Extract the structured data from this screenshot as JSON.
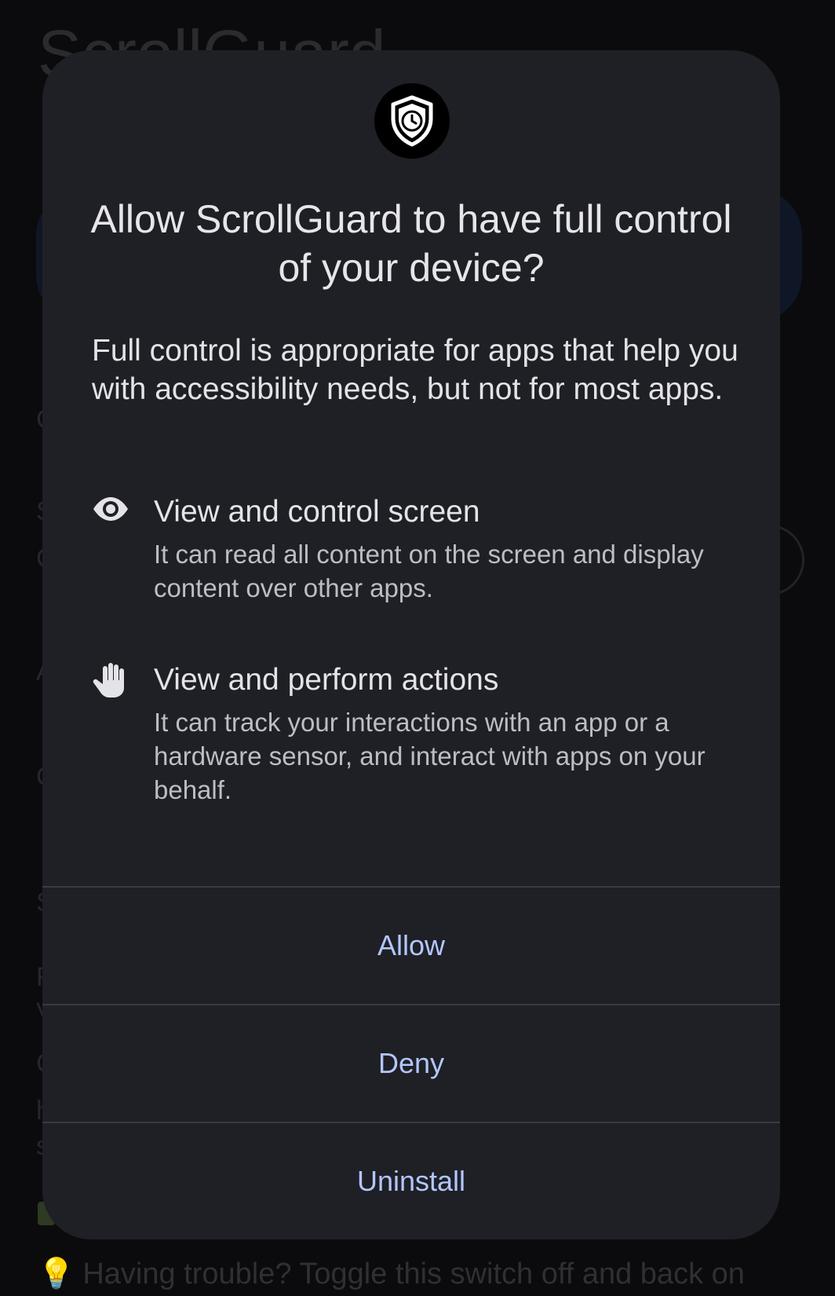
{
  "background": {
    "app_title": "ScrollGuard",
    "tip_text": "Having trouble? Toggle this switch off and back on"
  },
  "dialog": {
    "title": "Allow ScrollGuard to have full control of your device?",
    "description": "Full control is appropriate for apps that help you with accessibility needs, but not for most apps.",
    "permissions": [
      {
        "icon": "eye-icon",
        "title": "View and control screen",
        "body": "It can read all content on the screen and display content over other apps."
      },
      {
        "icon": "hand-icon",
        "title": "View and perform actions",
        "body": "It can track your interactions with an app or a hardware sensor, and interact with apps on your behalf."
      }
    ],
    "actions": {
      "allow": "Allow",
      "deny": "Deny",
      "uninstall": "Uninstall"
    }
  },
  "colors": {
    "dialog_bg": "#1f2025",
    "action_text": "#b3c6ff",
    "primary_text": "#e6e6ea",
    "secondary_text": "#bdbdc3"
  }
}
